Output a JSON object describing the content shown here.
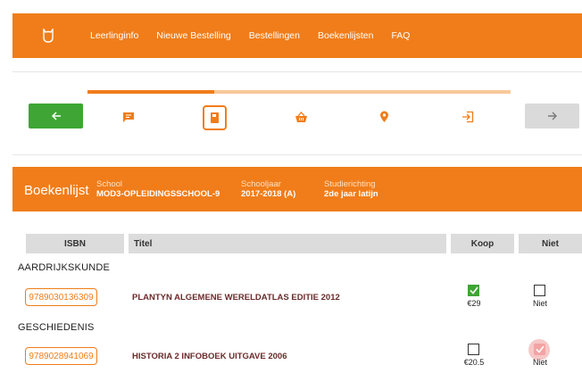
{
  "nav": {
    "logo": "owl-logo",
    "links": [
      "Leerlinginfo",
      "Nieuwe Bestelling",
      "Bestellingen",
      "Boekenlijsten",
      "FAQ"
    ]
  },
  "stepper": {
    "progress": 0.3,
    "steps": [
      "message-icon",
      "book-icon",
      "basket-icon",
      "location-pin-icon",
      "login-icon"
    ],
    "active_step": 1
  },
  "booklist": {
    "title": "Boekenlijst",
    "school_label": "School",
    "school_value": "MOD3-OPLEIDINGSSCHOOL-9",
    "year_label": "Schooljaar",
    "year_value": "2017-2018 (A)",
    "direction_label": "Studierichting",
    "direction_value": "2de jaar latijn"
  },
  "table": {
    "headers": {
      "isbn": "ISBN",
      "title": "Titel",
      "koop": "Koop",
      "niet": "Niet"
    },
    "sections": [
      {
        "name": "AARDRIJKSKUNDE",
        "rows": [
          {
            "isbn": "9789030136309",
            "title": "PLANTYN ALGEMENE WERELDATLAS EDITIE 2012",
            "koop_checked": true,
            "price": "€29",
            "niet_checked": false,
            "niet_label": "Niet"
          }
        ]
      },
      {
        "name": "GESCHIEDENIS",
        "rows": [
          {
            "isbn": "9789028941069",
            "title": "HISTORIA 2 INFOBOEK UITGAVE 2006",
            "koop_checked": false,
            "price": "€20.5",
            "niet_checked": true,
            "niet_label": "Niet"
          }
        ]
      }
    ]
  },
  "colors": {
    "brand": "#f07d1a",
    "success": "#3fa535",
    "muted": "#dadada"
  }
}
